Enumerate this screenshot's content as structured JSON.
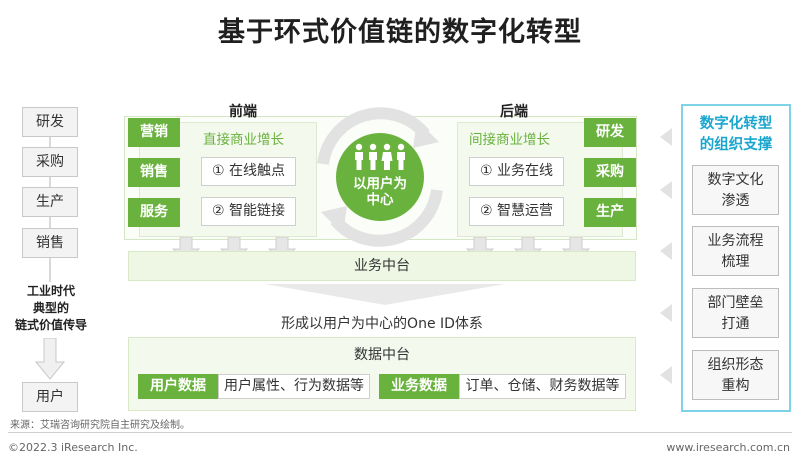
{
  "title": "基于环式价值链的数字化转型",
  "left_chain": {
    "items": [
      "研发",
      "采购",
      "生产",
      "销售"
    ],
    "caption_lines": [
      "工业时代",
      "典型的",
      "链式价值传导"
    ],
    "end_item": "用户"
  },
  "front_end": {
    "header": "前端",
    "subtitle": "直接商业增长",
    "buttons": [
      "营销",
      "销售",
      "服务"
    ],
    "points": [
      "① 在线触点",
      "② 智能链接"
    ]
  },
  "back_end": {
    "header": "后端",
    "subtitle": "间接商业增长",
    "buttons": [
      "研发",
      "采购",
      "生产"
    ],
    "points": [
      "① 业务在线",
      "② 智慧运营"
    ]
  },
  "center_circle": {
    "lines": [
      "以用户为",
      "中心"
    ]
  },
  "business_platform": "业务中台",
  "one_id_label": "形成以用户为中心的One ID体系",
  "data_platform": {
    "title": "数据中台",
    "user_data": {
      "tag": "用户数据",
      "desc": "用户属性、行为数据等"
    },
    "business_data": {
      "tag": "业务数据",
      "desc": "订单、仓储、财务数据等"
    }
  },
  "right_panel": {
    "title_lines": [
      "数字化转型",
      "的组织支撑"
    ],
    "items": [
      [
        "数字文化",
        "渗透"
      ],
      [
        "业务流程",
        "梳理"
      ],
      [
        "部门壁垒",
        "打通"
      ],
      [
        "组织形态",
        "重构"
      ]
    ]
  },
  "source": "来源：艾瑞咨询研究院自主研究及绘制。",
  "footer_left": "©2022.3 iResearch Inc.",
  "footer_right": "www.iresearch.com.cn",
  "colors": {
    "green": "#6ab23e",
    "cyan": "#1aa6cf",
    "light_green": "#eef6e4"
  }
}
